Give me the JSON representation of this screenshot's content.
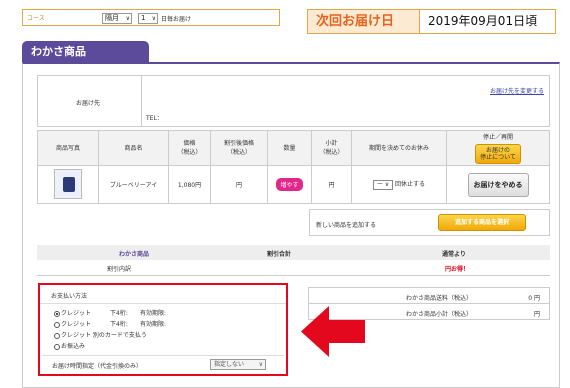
{
  "course": {
    "label": "コース",
    "select_month": "隔月",
    "select_day": "1",
    "suffix": "日毎お届け"
  },
  "next_delivery": {
    "label": "次回お届け日",
    "value": "2019年09月01日頃"
  },
  "tab": {
    "title": "わかさ商品"
  },
  "address": {
    "label": "お届け先",
    "change_link": "お届け先を変更する",
    "tel_label": "TEL："
  },
  "table": {
    "headers": [
      "商品写真",
      "商品名",
      "価格\n（税込）",
      "割引後価格\n（税込）",
      "数量",
      "小計\n（税込）",
      "期間を決めてのお休み",
      "停止／再開"
    ],
    "stop_info_button": "お届けの\n停止について",
    "row": {
      "name": "ブルーベリーアイ",
      "price": "1,080円",
      "discount_price": "円",
      "qty_button": "増やす",
      "subtotal": "円",
      "skip_select": "ー",
      "skip_text": "回休止する",
      "stop_button": "お届けをやめる"
    }
  },
  "add_product": {
    "label": "新しい商品を追加する",
    "button": "追加する商品を選択"
  },
  "summary": {
    "col1": "わかさ商品",
    "col2": "割引合計",
    "col3": "通常より",
    "breakdown_label": "割引内訳",
    "savings_value": "円お得！"
  },
  "payment": {
    "title": "お支払い方法",
    "options": [
      {
        "label": "クレジット",
        "mid": "下4桁:",
        "expiry": "有効期限:",
        "selected": true
      },
      {
        "label": "クレジット",
        "mid": "下4桁:",
        "expiry": "有効期限:",
        "selected": false
      },
      {
        "label": "クレジット 別のカードで支払う",
        "mid": "",
        "expiry": "",
        "selected": false
      },
      {
        "label": "お振込み",
        "mid": "",
        "expiry": "",
        "selected": false
      }
    ],
    "time_label": "お届け時間指定（代金引換のみ）",
    "time_value": "指定しない"
  },
  "fees": {
    "shipping_label": "わかさ商品送料（税込）",
    "shipping_value": "0 円",
    "subtotal_label": "わかさ商品小計（税込）",
    "subtotal_value": "円"
  },
  "colors": {
    "accent_purple": "#5c4a9a",
    "highlight_red": "#e4081e",
    "orange": "#e8621d"
  },
  "icons": {
    "pointer_arrow": "left-arrow-icon",
    "radio": "radio-icon"
  }
}
